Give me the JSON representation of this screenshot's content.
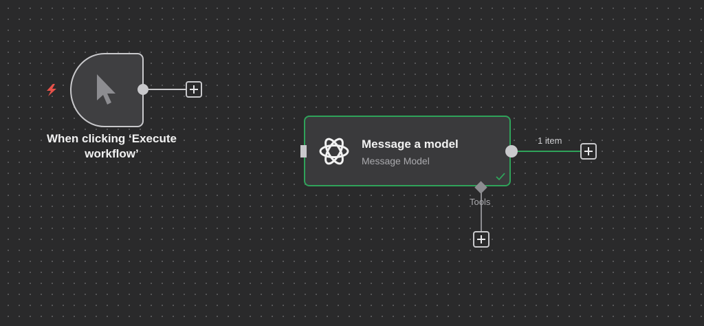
{
  "trigger_node": {
    "label": "When clicking ‘Execute workflow’",
    "icon": "cursor-pointer-icon",
    "badge_icon": "lightning-bolt-icon",
    "badge_color": "#e8524a"
  },
  "model_node": {
    "title": "Message a model",
    "subtitle": "Message Model",
    "icon": "openai-logo-icon",
    "status": "success",
    "status_icon": "check-icon",
    "border_color": "#2fa35a"
  },
  "connections": {
    "output_label": "1 item",
    "tools_label": "Tools"
  },
  "colors": {
    "canvas_background": "#2a2a2b",
    "node_background": "#3a3a3c",
    "success": "#2fa35a"
  }
}
